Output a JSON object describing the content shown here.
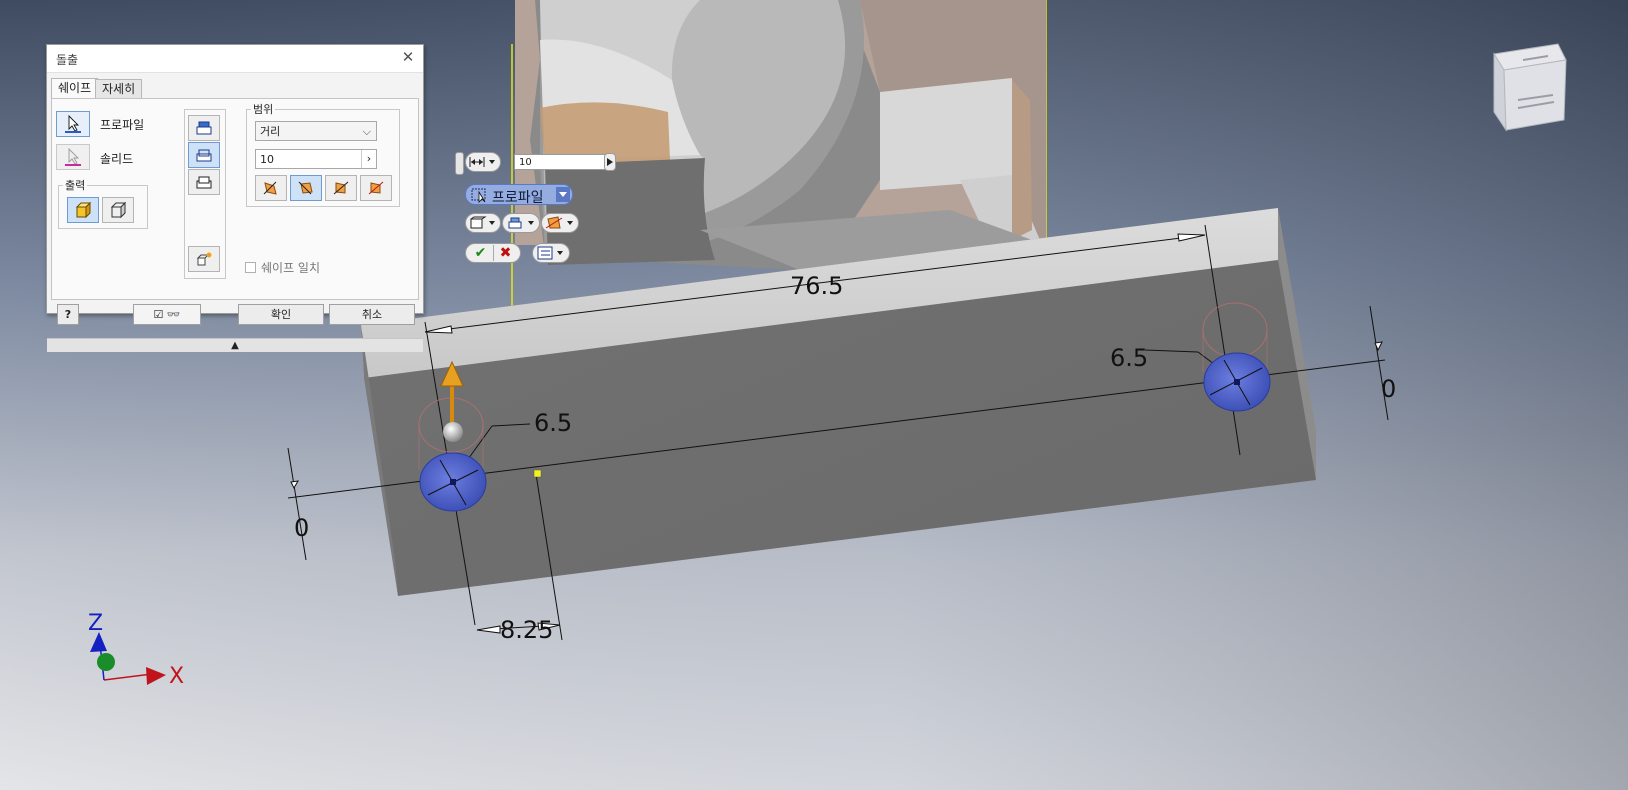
{
  "dialog": {
    "title": "돌출",
    "tabs": [
      {
        "label": "쉐이프"
      },
      {
        "label": "자세히"
      }
    ],
    "profile_label": "프로파일",
    "solid_label": "솔리드",
    "output_group_label": "출력",
    "range_group_label": "범위",
    "range_type": "거리",
    "distance_value": "10",
    "match_shape_label": "쉐이프 일치",
    "ok_label": "확인",
    "cancel_label": "취소"
  },
  "minitoolbar": {
    "distance_value": "10",
    "profile_label": "프로파일"
  },
  "dimensions": {
    "length_top": "76.5",
    "offset_left": "6.5",
    "offset_right": "6.5",
    "zero_left": "0",
    "zero_right": "0",
    "offset_bottom": "8.25"
  },
  "triad": {
    "z_label": "Z",
    "x_label": "X"
  },
  "colors": {
    "accent": "#94acdf",
    "hole": "#4a5fc0",
    "arrow": "#e0940e",
    "x_axis": "#c0141a",
    "z_axis": "#1420c0",
    "y_axis": "#1b8c2a"
  }
}
